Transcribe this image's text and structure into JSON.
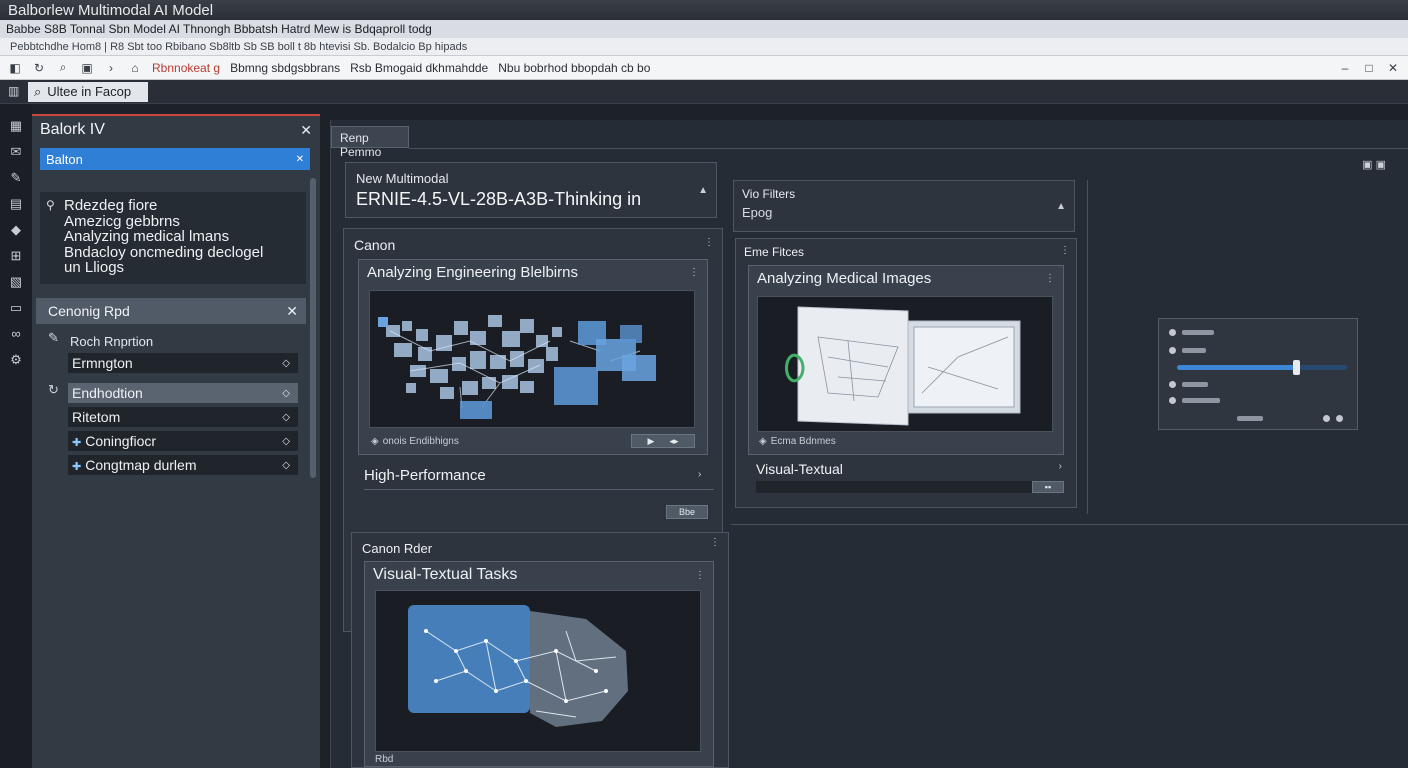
{
  "window": {
    "title": "Balborlew Multimodal AI Model",
    "menu_text": "Babbe S8B Tonnal Sbn Model AI Thnongh Bbbatsh Hatrd Mew is Bdqaproll todg",
    "bookmarks_text": "Pebbtchdhe Hom8 | R8 Sbt too Rbibano Sb8ltb Sb SB boll t 8b htevisi Sb. Bodalcio Bp hipads",
    "toolbar_link_red": "Rbnnokeat g",
    "toolbar_text_1": "Bbmng sbdgsbbrans",
    "toolbar_text_2": "Rsb Bmogaid dkhmahdde",
    "toolbar_text_3": "Nbu bobrhod bbopdah cb bo"
  },
  "search": {
    "label": "Ultee in Facop"
  },
  "side_panel": {
    "title": "Balork IV",
    "tab": "Balton",
    "list": [
      "Rdezdeg fiore",
      "Amezicg gebbrns",
      "Analyzing medical lmans",
      "Bndacloy oncmeding declogel",
      "un Lliogs"
    ],
    "section": "Cenonig Rpd",
    "field_label": "Roch Rnprtion",
    "rows": [
      "Ermngton",
      "Endhodtion",
      "Ritetom",
      "Coningfiocr",
      "Congtmap durlem"
    ]
  },
  "workspace": {
    "tab": "Renp Pemmo",
    "card_main": {
      "subtitle": "New Multimodal",
      "title": "ERNIE-4.5-VL-28B-A3B-Thinking in"
    },
    "card_canon": {
      "label": "Canon",
      "panel_title": "Analyzing Engineering Blelbirns",
      "footer": "onois Endibhigns",
      "caption": "High-Performance",
      "button": "Bbe"
    },
    "card_filters": {
      "label": "Vio Filters",
      "value": "Epog"
    },
    "card_medical": {
      "label": "Eme Fitces",
      "panel_title": "Analyzing Medical Images",
      "footer": "Ecma Bdnmes",
      "caption": "Visual-Textual"
    },
    "card_visual": {
      "label": "Canon Rder",
      "panel_title": "Visual-Textual Tasks",
      "footer": "Rbd"
    }
  },
  "settings_widget": {
    "slider_value": 0.7
  },
  "colors": {
    "accent": "#2f7fd6",
    "danger": "#c9473e",
    "panel": "#2d343e"
  }
}
